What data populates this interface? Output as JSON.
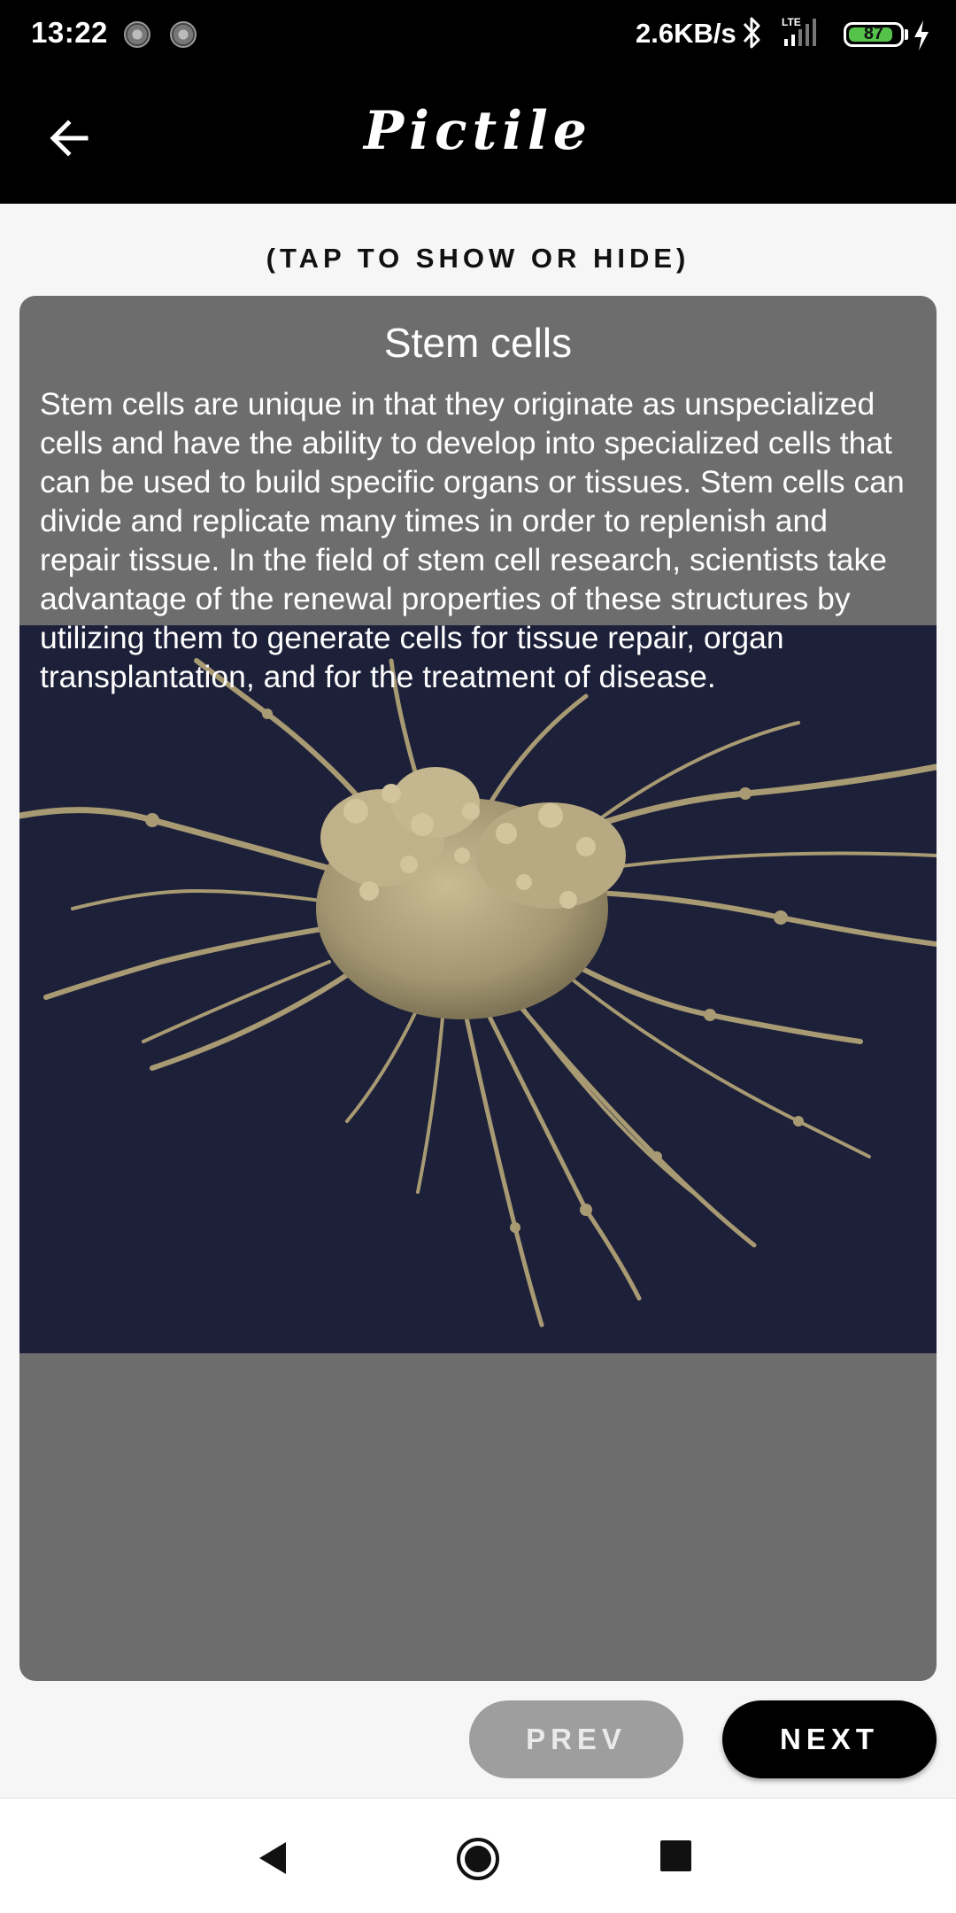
{
  "status_bar": {
    "time": "13:22",
    "network_speed": "2.6KB/s",
    "network_type": "LTE",
    "battery_level": "87",
    "battery_fraction": 0.87,
    "icons": [
      "notification-icon",
      "notification-icon",
      "bluetooth-icon",
      "signal-icon",
      "battery-icon",
      "charging-icon"
    ]
  },
  "app_bar": {
    "title": "Pictile",
    "back_icon": "arrow-left-icon"
  },
  "hint": "(TAP TO SHOW OR HIDE)",
  "card": {
    "title": "Stem cells",
    "description": "Stem cells are unique in that they originate as unspecialized cells and have the ability to develop into specialized cells that can be used to build specific organs or tissues. Stem cells can divide and replicate many times in order to replenish and repair tissue. In the field of stem cell research, scientists take advantage of the renewal properties of these structures by utilizing them to generate cells for tissue repair, organ transplantation, and for the treatment of disease.",
    "image_subject": "stem-cell-micrograph"
  },
  "buttons": {
    "prev": "PREV",
    "next": "NEXT"
  },
  "nav_bar": {
    "icons": [
      "back-triangle-icon",
      "home-circle-icon",
      "recents-square-icon"
    ]
  },
  "colors": {
    "app_bar": "#000000",
    "card_background": "#6d6d6d",
    "image_background": "#1d2039",
    "cell_color": "#b1a27a",
    "prev_button": "#9e9e9e",
    "next_button": "#000000",
    "battery_fill": "#55c24a"
  }
}
